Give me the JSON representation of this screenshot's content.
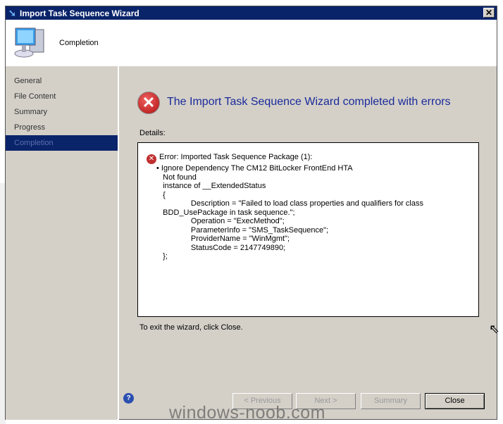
{
  "window": {
    "title": "Import Task Sequence Wizard",
    "header_page": "Completion"
  },
  "sidebar": {
    "items": [
      {
        "label": "General"
      },
      {
        "label": "File Content"
      },
      {
        "label": "Summary"
      },
      {
        "label": "Progress"
      },
      {
        "label": "Completion",
        "active": true
      }
    ]
  },
  "main": {
    "heading": "The Import Task Sequence Wizard completed with errors",
    "details_label": "Details:",
    "details_lines": [
      "Error: Imported Task Sequence Package (1):",
      "• Ignore Dependency The CM12 BitLocker FrontEnd HTA",
      "   Not found",
      "   instance of __ExtendedStatus",
      "   {",
      "                Description = \"Failed to load class properties and qualifiers for class",
      "   BDD_UsePackage in task sequence.\";",
      "                Operation = \"ExecMethod\";",
      "                ParameterInfo = \"SMS_TaskSequence\";",
      "                ProviderName = \"WinMgmt\";",
      "                StatusCode = 2147749890;",
      "   };"
    ],
    "exit_text": "To exit the wizard, click Close."
  },
  "buttons": {
    "previous": "< Previous",
    "next": "Next >",
    "summary": "Summary",
    "close": "Close"
  },
  "watermark": "windows-noob.com",
  "colors": {
    "titlebar": "#0a246a",
    "heading": "#1a2a9a",
    "error": "#c03030"
  }
}
